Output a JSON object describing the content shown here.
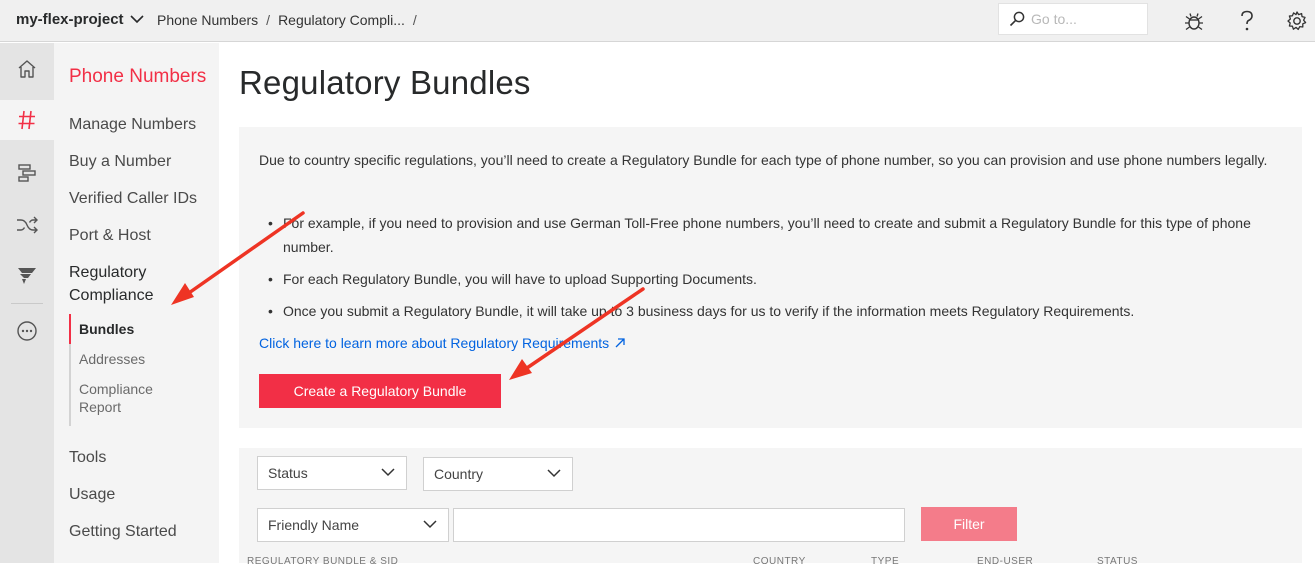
{
  "topbar": {
    "project": "my-flex-project",
    "breadcrumbs": [
      "Phone Numbers",
      "Regulatory Compli..."
    ],
    "breadcrumb_sep": "/",
    "search_placeholder": "Go to...",
    "icons": [
      "bug-icon",
      "help-icon",
      "gear-icon"
    ]
  },
  "rail": {
    "items": [
      "home-icon",
      "hash-icon",
      "studio-icon",
      "shuffle-icon",
      "flex-icon",
      "more-icon"
    ],
    "active": "hash-icon"
  },
  "sidenav": {
    "title": "Phone Numbers",
    "items": [
      "Manage Numbers",
      "Buy a Number",
      "Verified Caller IDs",
      "Port & Host"
    ],
    "section": "Regulatory Compliance",
    "subitems": [
      "Bundles",
      "Addresses",
      "Compliance Report"
    ],
    "bottom_items": [
      "Tools",
      "Usage",
      "Getting Started"
    ]
  },
  "main": {
    "title": "Regulatory Bundles",
    "intro": "Due to country specific regulations, you’ll need to create a Regulatory Bundle for each type of phone number, so you can provision and use phone numbers legally.",
    "bullets": [
      "For example, if you need to provision and use German Toll-Free phone numbers, you’ll need to create and submit a Regulatory Bundle for this type of phone number.",
      "For each Regulatory Bundle, you will have to upload Supporting Documents.",
      "Once you submit a Regulatory Bundle, it will take up to 3 business days for us to verify if the information meets Regulatory Requirements."
    ],
    "learn_link": "Click here to learn more about Regulatory Requirements",
    "create_button": "Create a Regulatory Bundle"
  },
  "filters": {
    "status": "Status",
    "country": "Country",
    "field": "Friendly Name",
    "text_value": "",
    "filter_button": "Filter",
    "columns": [
      "REGULATORY BUNDLE & SID",
      "COUNTRY",
      "TYPE",
      "END-USER",
      "STATUS"
    ]
  },
  "colors": {
    "brand_red": "#f22f46",
    "link_blue": "#0263e0",
    "arrow_red": "#ee3424"
  }
}
